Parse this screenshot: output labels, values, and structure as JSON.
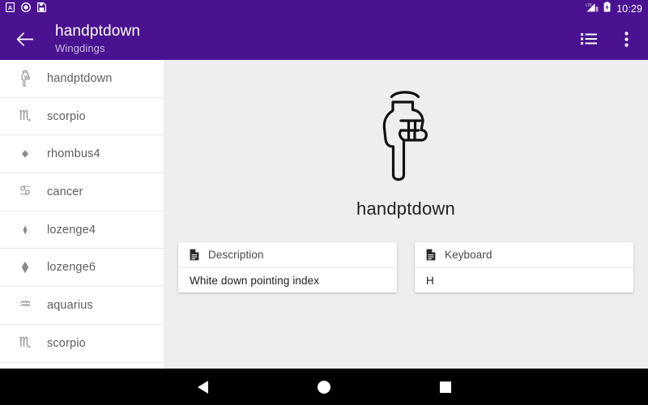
{
  "statusbar": {
    "notification_icons": [
      "letter-a-badge-icon",
      "record-circle-icon",
      "sim-card-icon"
    ],
    "network_label": "LTE",
    "signal_icon": "signal-bars-icon",
    "battery_icon": "battery-charging-icon",
    "clock": "10:29"
  },
  "appbar": {
    "back_icon": "back-arrow-icon",
    "title": "handptdown",
    "subtitle": "Wingdings",
    "actions": [
      {
        "name": "list-view-icon",
        "label": "List view"
      },
      {
        "name": "overflow-menu-icon",
        "label": "More options"
      }
    ]
  },
  "sidebar": {
    "items": [
      {
        "label": "handptdown",
        "glyph": "hand-point-down-glyph"
      },
      {
        "label": "scorpio",
        "glyph": "scorpio-glyph",
        "sym": "♏"
      },
      {
        "label": "rhombus4",
        "glyph": "rhombus4-glyph"
      },
      {
        "label": "cancer",
        "glyph": "cancer-glyph",
        "sym": "♋"
      },
      {
        "label": "lozenge4",
        "glyph": "lozenge4-glyph"
      },
      {
        "label": "lozenge6",
        "glyph": "lozenge6-glyph"
      },
      {
        "label": "aquarius",
        "glyph": "aquarius-glyph",
        "sym": "♒"
      },
      {
        "label": "scorpio",
        "glyph": "scorpio-glyph",
        "sym": "♏"
      }
    ]
  },
  "main": {
    "hero_glyph": "hand-point-down-large-glyph",
    "glyph_name": "handptdown",
    "cards": [
      {
        "icon": "document-icon",
        "title": "Description",
        "value": "White down pointing index"
      },
      {
        "icon": "document-icon",
        "title": "Keyboard",
        "value": "H"
      }
    ]
  },
  "navbar": {
    "buttons": [
      {
        "name": "nav-back-button",
        "label": "Back"
      },
      {
        "name": "nav-home-button",
        "label": "Home"
      },
      {
        "name": "nav-recents-button",
        "label": "Recents"
      }
    ]
  },
  "colors": {
    "primary": "#4a1290",
    "background": "#eeeeee",
    "surface": "#ffffff",
    "subtitle": "#cbb6e0"
  }
}
